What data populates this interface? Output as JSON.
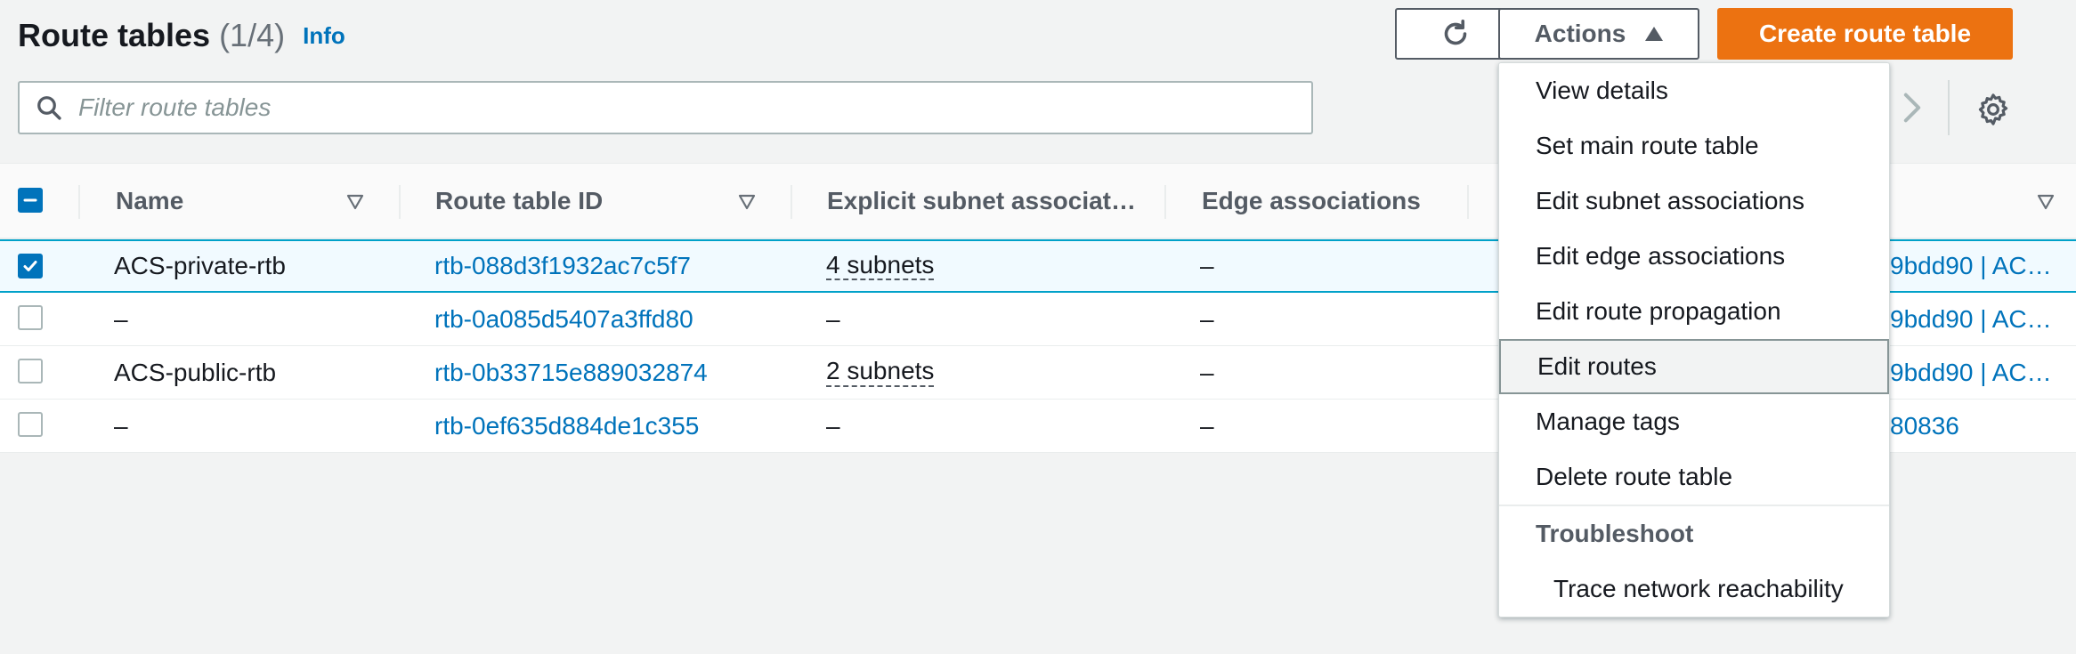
{
  "header": {
    "title": "Route tables",
    "count": "(1/4)",
    "info_label": "Info"
  },
  "toolbar": {
    "refresh_icon": "refresh-icon",
    "actions_label": "Actions",
    "create_label": "Create route table"
  },
  "search": {
    "placeholder": "Filter route tables",
    "value": ""
  },
  "table": {
    "columns": {
      "name": "Name",
      "route_table_id": "Route table ID",
      "explicit_subnet": "Explicit subnet associat…",
      "edge": "Edge associations"
    },
    "rows": [
      {
        "name": "ACS-private-rtb",
        "id": "rtb-088d3f1932ac7c5f7",
        "subnets": "4 subnets",
        "edge": "–",
        "vpc": "9bdd90 | AC…",
        "selected": true
      },
      {
        "name": "–",
        "id": "rtb-0a085d5407a3ffd80",
        "subnets": "–",
        "edge": "–",
        "vpc": "9bdd90 | AC…",
        "selected": false
      },
      {
        "name": "ACS-public-rtb",
        "id": "rtb-0b33715e889032874",
        "subnets": "2 subnets",
        "edge": "–",
        "vpc": "9bdd90 | AC…",
        "selected": false
      },
      {
        "name": "–",
        "id": "rtb-0ef635d884de1c355",
        "subnets": "–",
        "edge": "–",
        "vpc": "80836",
        "selected": false
      }
    ]
  },
  "actions_menu": {
    "items": [
      "View details",
      "Set main route table",
      "Edit subnet associations",
      "Edit edge associations",
      "Edit route propagation",
      "Edit routes",
      "Manage tags",
      "Delete route table"
    ],
    "hovered": "Edit routes",
    "group_label": "Troubleshoot",
    "group_items": [
      "Trace network reachability"
    ]
  },
  "colors": {
    "accent": "#0073bb",
    "primary_button": "#ec7211",
    "selected_row": "#f1faff",
    "selected_border": "#00a1c9"
  }
}
